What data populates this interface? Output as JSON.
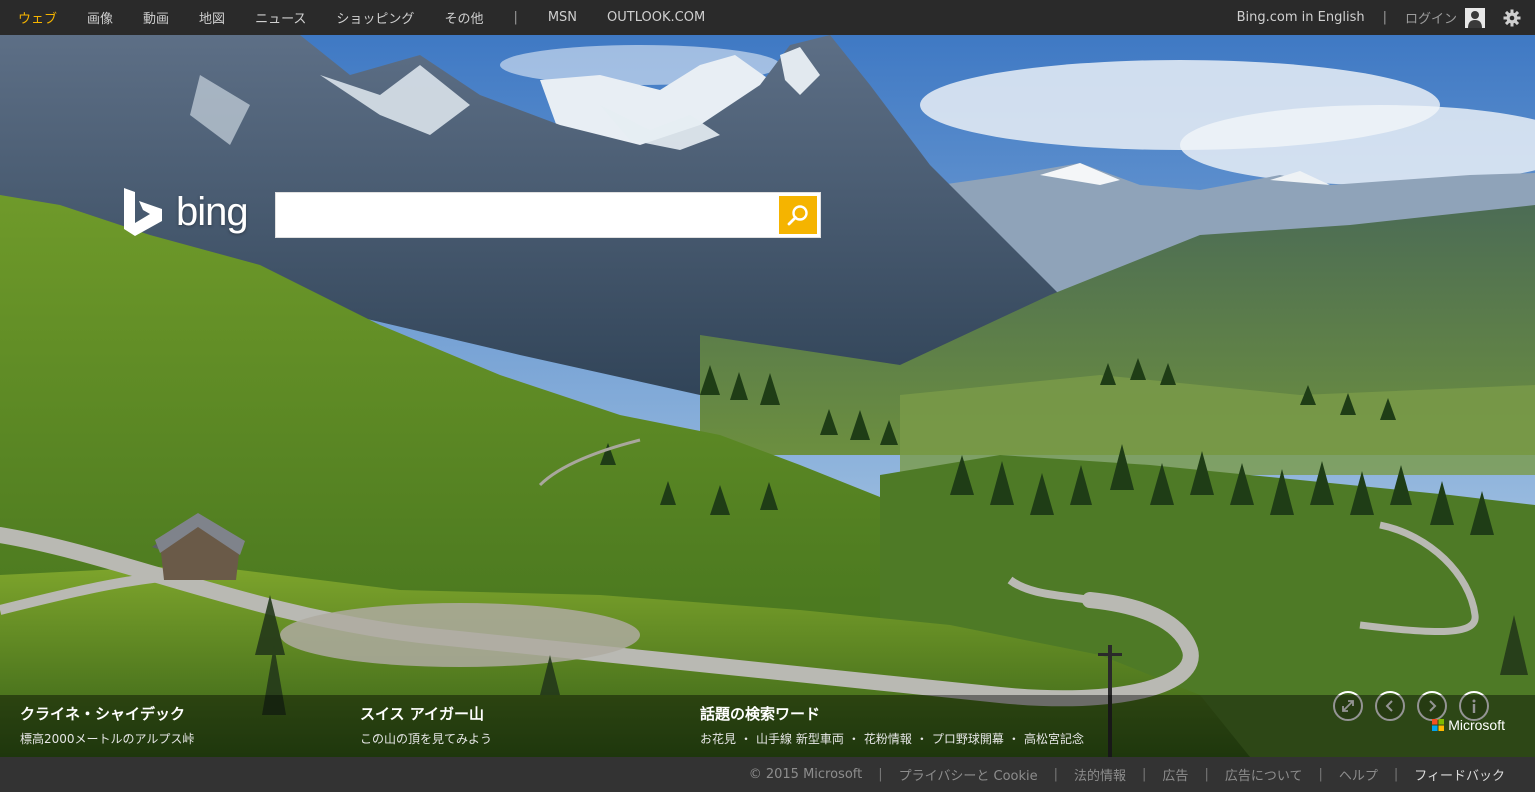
{
  "topnav": {
    "items": [
      {
        "label": "ウェブ",
        "active": true
      },
      {
        "label": "画像"
      },
      {
        "label": "動画"
      },
      {
        "label": "地図"
      },
      {
        "label": "ニュース"
      },
      {
        "label": "ショッピング"
      },
      {
        "label": "その他"
      }
    ],
    "separator": "|",
    "extra": [
      "MSN",
      "OUTLOOK.COM"
    ],
    "active_color": "#f5b400"
  },
  "topright": {
    "english_link": "Bing.com in English",
    "separator": "|",
    "login": "ログイン",
    "user_icon": "user-icon",
    "settings_icon": "gear-icon"
  },
  "logo": {
    "word": "bing"
  },
  "search": {
    "value": "",
    "placeholder": "",
    "button_icon": "search-icon",
    "button_color": "#f5b400"
  },
  "hero": {
    "description_of_scene": "",
    "controls": [
      "fullscreen-icon",
      "prev-icon",
      "next-icon",
      "info-icon"
    ]
  },
  "captions": [
    {
      "title": "クライネ・シャイデック",
      "subtitle": "標高2000メートルのアルプス峠"
    },
    {
      "title": "スイス アイガー山",
      "subtitle": "この山の頂を見てみよう"
    }
  ],
  "trending": {
    "title": "話題の検索ワード",
    "items": [
      "お花見",
      "山手線 新型車両",
      "花粉情報",
      "プロ野球開幕",
      "高松宮記念"
    ],
    "separator": "・"
  },
  "microsoft": {
    "text": "Microsoft",
    "logo_colors": [
      "#f25022",
      "#7fba00",
      "#00a4ef",
      "#ffb900"
    ]
  },
  "footer": {
    "copyright": "© 2015 Microsoft",
    "links": [
      "プライバシーと Cookie",
      "法的情報",
      "広告",
      "広告について",
      "ヘルプ"
    ],
    "feedback": "フィードバック",
    "separator": "|"
  }
}
